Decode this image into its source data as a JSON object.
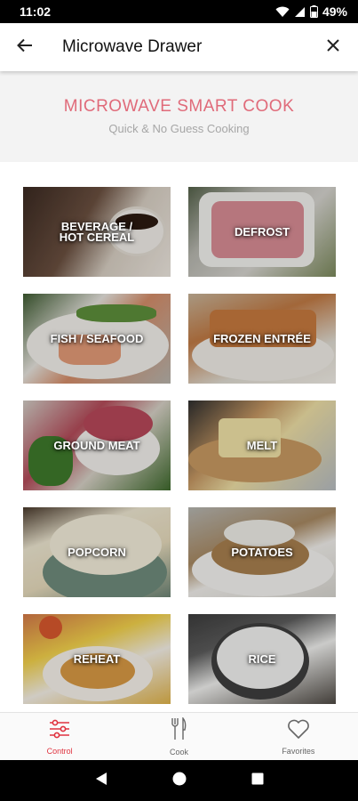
{
  "status_bar": {
    "time": "11:02",
    "battery": "49%",
    "icons": [
      "wifi-icon",
      "signal-icon",
      "battery-icon"
    ]
  },
  "app_bar": {
    "title": "Microwave Drawer",
    "back_icon": "arrow-left-icon",
    "close_icon": "close-icon"
  },
  "hero": {
    "title": "MICROWAVE SMART COOK",
    "subtitle": "Quick & No Guess Cooking"
  },
  "tiles": [
    {
      "label": "BEVERAGE /\nHOT CEREAL"
    },
    {
      "label": "DEFROST"
    },
    {
      "label": "FISH / SEAFOOD"
    },
    {
      "label": "FROZEN ENTRÉE"
    },
    {
      "label": "GROUND MEAT"
    },
    {
      "label": "MELT"
    },
    {
      "label": "POPCORN"
    },
    {
      "label": "POTATOES"
    },
    {
      "label": "REHEAT"
    },
    {
      "label": "RICE"
    }
  ],
  "bottom_nav": {
    "items": [
      {
        "label": "Control",
        "icon": "sliders-icon",
        "active": true
      },
      {
        "label": "Cook",
        "icon": "fork-knife-icon",
        "active": false
      },
      {
        "label": "Favorites",
        "icon": "heart-icon",
        "active": false
      }
    ]
  },
  "colors": {
    "accent": "#e0333f",
    "hero_title": "#e06b7a",
    "hero_bg": "#f3f3f3"
  }
}
